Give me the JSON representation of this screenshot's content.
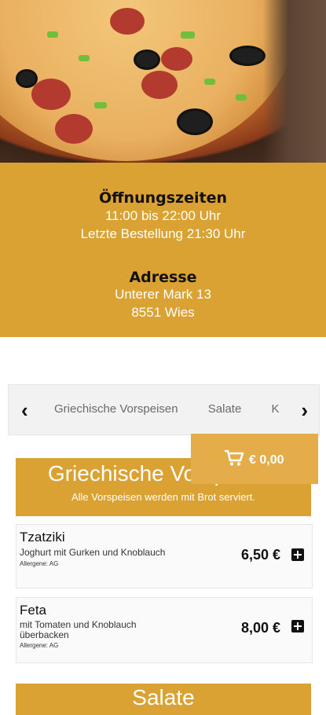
{
  "info": {
    "hours_heading": "Öffnungszeiten",
    "hours_line1": "11:00 bis 22:00 Uhr",
    "hours_line2": "Letzte Bestellung 21:30 Uhr",
    "address_heading": "Adresse",
    "address_line1": "Unterer Mark 13",
    "address_line2": "8551 Wies"
  },
  "categories": {
    "items": [
      "Griechische Vorspeisen",
      "Salate",
      "K"
    ],
    "prev_icon": "chevron-left-icon",
    "next_icon": "chevron-right-icon"
  },
  "cart": {
    "total": "€ 0,00",
    "icon": "cart-icon"
  },
  "sections": [
    {
      "title": "Griechische Vorspeisen",
      "subtitle": "Alle Vorspeisen werden mit Brot serviert.",
      "items": [
        {
          "name": "Tzatziki",
          "description": "Joghurt mit Gurken und Knoblauch",
          "allergens": "Allergene: AG",
          "price": "6,50 €"
        },
        {
          "name": "Feta",
          "description": "mit Tomaten und Knoblauch überbacken",
          "allergens": "Allergene: AG",
          "price": "8,00 €"
        }
      ]
    },
    {
      "title": "Salate"
    }
  ],
  "colors": {
    "accent": "#d9a232",
    "cart": "#e4ad4a"
  }
}
